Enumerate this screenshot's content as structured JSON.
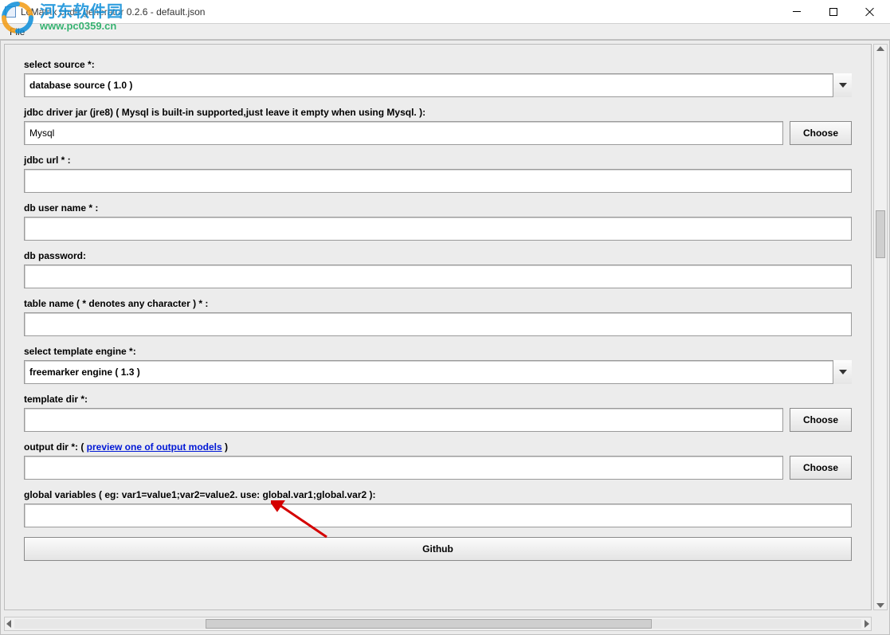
{
  "window": {
    "title": "LcMatrix code generator 0.2.6 - default.json"
  },
  "menu": {
    "file": "File"
  },
  "labels": {
    "select_source": "select source *:",
    "jdbc_driver": "jdbc driver jar (jre8) ( Mysql is built-in supported,just leave it empty when using Mysql. ):",
    "jdbc_url": "jdbc url * :",
    "db_user": "db user name * :",
    "db_password": "db password:",
    "table_name": "table name ( * denotes any character ) * :",
    "select_engine": "select template engine *:",
    "template_dir": "template dir *:",
    "output_dir_prefix": "output dir *:  ( ",
    "output_dir_link": "preview one of output models",
    "output_dir_suffix": " )",
    "global_vars": "global variables ( eg: var1=value1;var2=value2. use: global.var1;global.var2 ):"
  },
  "values": {
    "source": "database source ( 1.0 )",
    "jdbc_driver": "Mysql",
    "jdbc_url": "",
    "db_user": "",
    "db_password": "",
    "table_name": "",
    "engine": "freemarker engine ( 1.3 )",
    "template_dir": "",
    "output_dir": "",
    "global_vars": ""
  },
  "buttons": {
    "choose": "Choose",
    "github": "Github"
  },
  "watermark": {
    "zh": "河东软件园",
    "url": "www.pc0359.cn"
  }
}
